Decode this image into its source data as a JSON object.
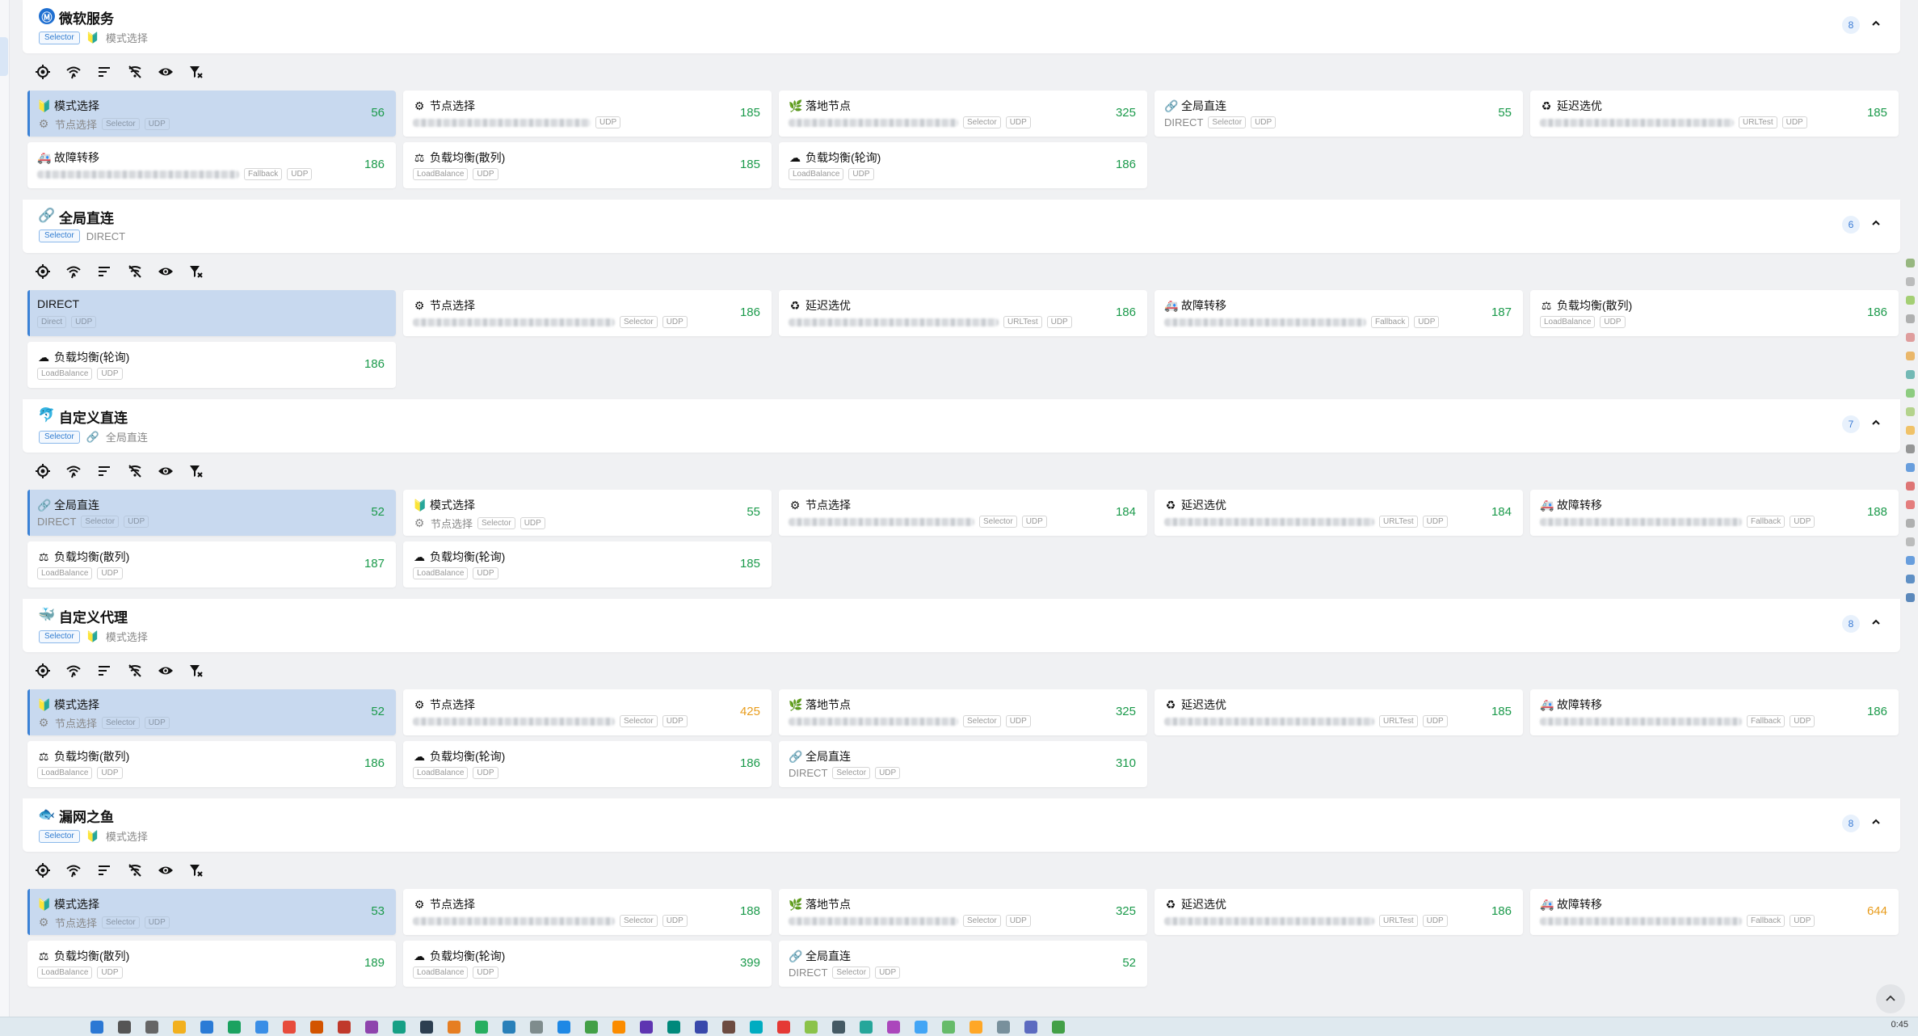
{
  "groups": [
    {
      "name": "微软服务",
      "icon": "Ⓜ",
      "icon_color": "#1f6fd1",
      "type": "Selector",
      "current_icon": "🔰",
      "current": "模式选择",
      "count": "8",
      "proxies": [
        {
          "icon": "🔰",
          "name": "模式选择",
          "sub_icon": "⚙",
          "sub": "节点选择",
          "tags": [
            "Selector",
            "UDP"
          ],
          "delay": "56",
          "active": true
        },
        {
          "icon": "⚙",
          "name": "节点选择",
          "blur": 220,
          "tags": [
            "UDP"
          ],
          "delay": "185"
        },
        {
          "icon": "🌿",
          "name": "落地节点",
          "blur": 210,
          "tags": [
            "Selector",
            "UDP"
          ],
          "delay": "325"
        },
        {
          "icon": "🔗",
          "name": "全局直连",
          "sub": "DIRECT",
          "tags": [
            "Selector",
            "UDP"
          ],
          "delay": "55"
        },
        {
          "icon": "♻",
          "name": "延迟选优",
          "blur": 240,
          "tags": [
            "URLTest",
            "UDP"
          ],
          "delay": "185"
        },
        {
          "icon": "🚑",
          "name": "故障转移",
          "blur": 250,
          "tags": [
            "Fallback",
            "UDP"
          ],
          "delay": "186"
        },
        {
          "icon": "⚖",
          "name": "负载均衡(散列)",
          "tags": [
            "LoadBalance",
            "UDP"
          ],
          "delay": "185"
        },
        {
          "icon": "☁",
          "name": "负载均衡(轮询)",
          "tags": [
            "LoadBalance",
            "UDP"
          ],
          "delay": "186"
        }
      ]
    },
    {
      "name": "全局直连",
      "icon": "🔗",
      "icon_color": "transparent",
      "type": "Selector",
      "current_icon": "",
      "current": "DIRECT",
      "count": "6",
      "proxies": [
        {
          "icon": "",
          "name": "DIRECT",
          "tags": [
            "Direct",
            "UDP"
          ],
          "delay": "",
          "active": true
        },
        {
          "icon": "⚙",
          "name": "节点选择",
          "blur": 250,
          "tags": [
            "Selector",
            "UDP"
          ],
          "delay": "186"
        },
        {
          "icon": "♻",
          "name": "延迟选优",
          "blur": 260,
          "tags": [
            "URLTest",
            "UDP"
          ],
          "delay": "186"
        },
        {
          "icon": "🚑",
          "name": "故障转移",
          "blur": 250,
          "tags": [
            "Fallback",
            "UDP"
          ],
          "delay": "187"
        },
        {
          "icon": "⚖",
          "name": "负载均衡(散列)",
          "tags": [
            "LoadBalance",
            "UDP"
          ],
          "delay": "186"
        },
        {
          "icon": "☁",
          "name": "负载均衡(轮询)",
          "tags": [
            "LoadBalance",
            "UDP"
          ],
          "delay": "186"
        }
      ]
    },
    {
      "name": "自定义直连",
      "icon": "🐬",
      "icon_color": "transparent",
      "type": "Selector",
      "current_icon": "🔗",
      "current": "全局直连",
      "count": "7",
      "proxies": [
        {
          "icon": "🔗",
          "name": "全局直连",
          "sub": "DIRECT",
          "tags": [
            "Selector",
            "UDP"
          ],
          "delay": "52",
          "active": true
        },
        {
          "icon": "🔰",
          "name": "模式选择",
          "sub_icon": "⚙",
          "sub": "节点选择",
          "tags": [
            "Selector",
            "UDP"
          ],
          "delay": "55"
        },
        {
          "icon": "⚙",
          "name": "节点选择",
          "blur": 230,
          "tags": [
            "Selector",
            "UDP"
          ],
          "delay": "184"
        },
        {
          "icon": "♻",
          "name": "延迟选优",
          "blur": 260,
          "tags": [
            "URLTest",
            "UDP"
          ],
          "delay": "184"
        },
        {
          "icon": "🚑",
          "name": "故障转移",
          "blur": 250,
          "tags": [
            "Fallback",
            "UDP"
          ],
          "delay": "188"
        },
        {
          "icon": "⚖",
          "name": "负载均衡(散列)",
          "tags": [
            "LoadBalance",
            "UDP"
          ],
          "delay": "187"
        },
        {
          "icon": "☁",
          "name": "负载均衡(轮询)",
          "tags": [
            "LoadBalance",
            "UDP"
          ],
          "delay": "185"
        }
      ]
    },
    {
      "name": "自定义代理",
      "icon": "🐳",
      "icon_color": "transparent",
      "type": "Selector",
      "current_icon": "🔰",
      "current": "模式选择",
      "count": "8",
      "proxies": [
        {
          "icon": "🔰",
          "name": "模式选择",
          "sub_icon": "⚙",
          "sub": "节点选择",
          "tags": [
            "Selector",
            "UDP"
          ],
          "delay": "52",
          "active": true
        },
        {
          "icon": "⚙",
          "name": "节点选择",
          "blur": 250,
          "tags": [
            "Selector",
            "UDP"
          ],
          "delay": "425",
          "warn": true
        },
        {
          "icon": "🌿",
          "name": "落地节点",
          "blur": 210,
          "tags": [
            "Selector",
            "UDP"
          ],
          "delay": "325"
        },
        {
          "icon": "♻",
          "name": "延迟选优",
          "blur": 260,
          "tags": [
            "URLTest",
            "UDP"
          ],
          "delay": "185"
        },
        {
          "icon": "🚑",
          "name": "故障转移",
          "blur": 250,
          "tags": [
            "Fallback",
            "UDP"
          ],
          "delay": "186"
        },
        {
          "icon": "⚖",
          "name": "负载均衡(散列)",
          "tags": [
            "LoadBalance",
            "UDP"
          ],
          "delay": "186"
        },
        {
          "icon": "☁",
          "name": "负载均衡(轮询)",
          "tags": [
            "LoadBalance",
            "UDP"
          ],
          "delay": "186"
        },
        {
          "icon": "🔗",
          "name": "全局直连",
          "sub": "DIRECT",
          "tags": [
            "Selector",
            "UDP"
          ],
          "delay": "310"
        }
      ]
    },
    {
      "name": "漏网之鱼",
      "icon": "🐟",
      "icon_color": "transparent",
      "type": "Selector",
      "current_icon": "🔰",
      "current": "模式选择",
      "count": "8",
      "proxies": [
        {
          "icon": "🔰",
          "name": "模式选择",
          "sub_icon": "⚙",
          "sub": "节点选择",
          "tags": [
            "Selector",
            "UDP"
          ],
          "delay": "53",
          "active": true
        },
        {
          "icon": "⚙",
          "name": "节点选择",
          "blur": 250,
          "tags": [
            "Selector",
            "UDP"
          ],
          "delay": "188"
        },
        {
          "icon": "🌿",
          "name": "落地节点",
          "blur": 210,
          "tags": [
            "Selector",
            "UDP"
          ],
          "delay": "325"
        },
        {
          "icon": "♻",
          "name": "延迟选优",
          "blur": 260,
          "tags": [
            "URLTest",
            "UDP"
          ],
          "delay": "186"
        },
        {
          "icon": "🚑",
          "name": "故障转移",
          "blur": 250,
          "tags": [
            "Fallback",
            "UDP"
          ],
          "delay": "644",
          "warn": true
        },
        {
          "icon": "⚖",
          "name": "负载均衡(散列)",
          "tags": [
            "LoadBalance",
            "UDP"
          ],
          "delay": "189"
        },
        {
          "icon": "☁",
          "name": "负载均衡(轮询)",
          "tags": [
            "LoadBalance",
            "UDP"
          ],
          "delay": "399"
        },
        {
          "icon": "🔗",
          "name": "全局直连",
          "sub": "DIRECT",
          "tags": [
            "Selector",
            "UDP"
          ],
          "delay": "52"
        }
      ]
    }
  ],
  "toolbar_icons": [
    "locate-icon",
    "delay-test-icon",
    "sort-icon",
    "filter-off-icon",
    "eye-icon",
    "filter-clear-icon"
  ],
  "colors": {
    "accent": "#3b82d6",
    "active_bg": "#c8d9ef",
    "delay_good": "#1b9a4b",
    "delay_warn": "#e89c1c"
  },
  "taskbar": {
    "clock": "0:45"
  }
}
